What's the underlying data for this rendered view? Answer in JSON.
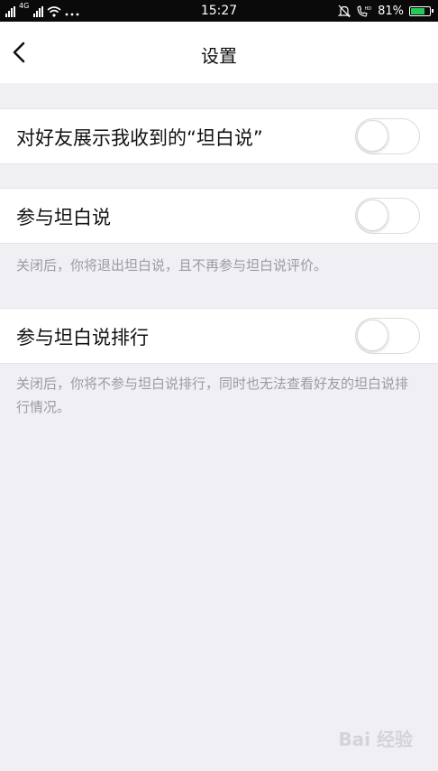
{
  "status_bar": {
    "time": "15:27",
    "network": "4G",
    "battery_percent": "81%",
    "battery_level": 0.81,
    "icons": [
      "signal-icon",
      "wifi-icon",
      "more-dots-icon",
      "silent-bell-icon",
      "hd-call-icon",
      "battery-icon"
    ]
  },
  "header": {
    "title": "设置",
    "back_icon": "chevron-left-icon"
  },
  "settings": [
    {
      "label": "对好友展示我收到的“坦白说”",
      "enabled": false
    },
    {
      "label": "参与坦白说",
      "enabled": false,
      "note": "关闭后，你将退出坦白说，且不再参与坦白说评价。"
    },
    {
      "label": "参与坦白说排行",
      "enabled": false,
      "note": "关闭后，你将不参与坦白说排行，同时也无法查看好友的坦白说排行情况。"
    }
  ],
  "watermark": "Bai 经验",
  "colors": {
    "background": "#efeff4",
    "surface": "#ffffff",
    "note_text": "#9b9ba0",
    "battery": "#22c85a"
  }
}
